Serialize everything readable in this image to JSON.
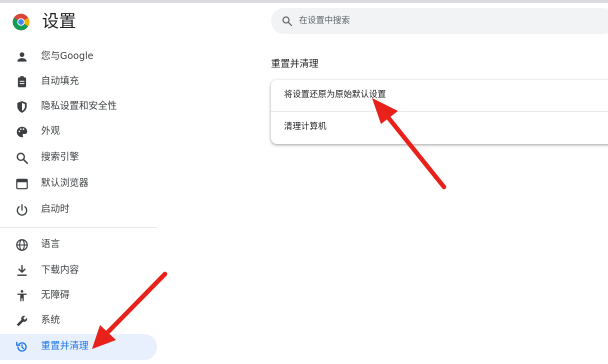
{
  "colors": {
    "accent": "#1a73e8",
    "active_bg": "#e8f0fe",
    "icon": "#3c4043",
    "arrow": "#e8221b"
  },
  "app": {
    "title": "设置",
    "logo_icon": "chrome-logo"
  },
  "search": {
    "placeholder": "在设置中搜索",
    "value": "",
    "icon": "search-icon"
  },
  "sidebar": {
    "items": [
      {
        "label": "您与Google",
        "icon": "person-icon"
      },
      {
        "label": "自动填充",
        "icon": "clipboard-icon"
      },
      {
        "label": "隐私设置和安全性",
        "icon": "shield-icon"
      },
      {
        "label": "外观",
        "icon": "palette-icon"
      },
      {
        "label": "搜索引擎",
        "icon": "search-icon"
      },
      {
        "label": "默认浏览器",
        "icon": "browser-icon"
      },
      {
        "label": "启动时",
        "icon": "power-icon"
      },
      {
        "label": "语言",
        "icon": "globe-icon"
      },
      {
        "label": "下载内容",
        "icon": "download-icon"
      },
      {
        "label": "无障碍",
        "icon": "accessibility-icon"
      },
      {
        "label": "系统",
        "icon": "wrench-icon"
      },
      {
        "label": "重置并清理",
        "icon": "reset-icon",
        "active": true
      }
    ]
  },
  "main": {
    "section_title": "重置并清理",
    "rows": [
      {
        "label": "将设置还原为原始默认设置"
      },
      {
        "label": "清理计算机"
      }
    ]
  }
}
